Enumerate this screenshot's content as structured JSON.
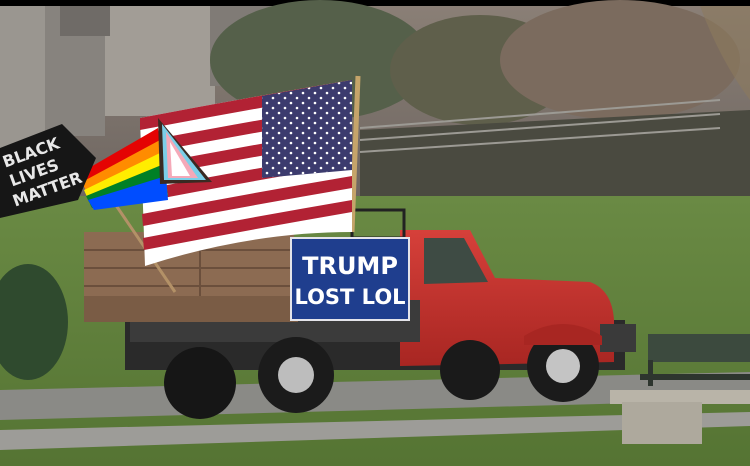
{
  "photo": {
    "banner": {
      "line1": "TRUMP",
      "line2": "LOST LOL"
    },
    "blm_flag": {
      "lines": [
        "BLACK",
        "LIVES",
        "MATTER"
      ]
    },
    "colors": {
      "grass": "#5e7d3a",
      "truck_red": "#c8302c",
      "banner_blue": "#1f3e8e",
      "flag_red": "#b22234",
      "flag_blue": "#3c3b6e"
    }
  }
}
